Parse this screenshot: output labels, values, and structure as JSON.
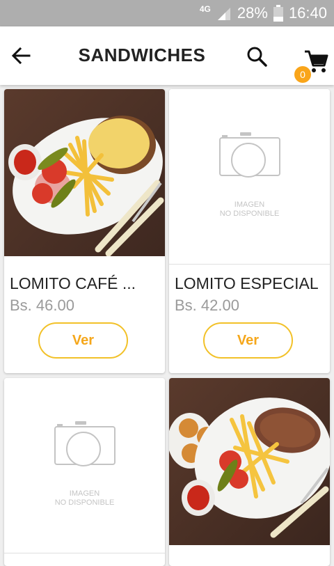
{
  "status_bar": {
    "network": "4G",
    "battery": "28%",
    "time": "16:40"
  },
  "header": {
    "title": "SANDWICHES",
    "cart_count": "0"
  },
  "placeholder": {
    "line1": "IMAGEN",
    "line2": "NO DISPONIBLE"
  },
  "products": [
    {
      "name": "LOMITO CAFÉ ...",
      "price": "Bs. 46.00",
      "button": "Ver"
    },
    {
      "name": "LOMITO ESPECIAL",
      "price": "Bs. 42.00",
      "button": "Ver"
    }
  ],
  "colors": {
    "accent": "#f9a51a",
    "button_border": "#f2c128",
    "status_bar": "#aeaeae"
  }
}
